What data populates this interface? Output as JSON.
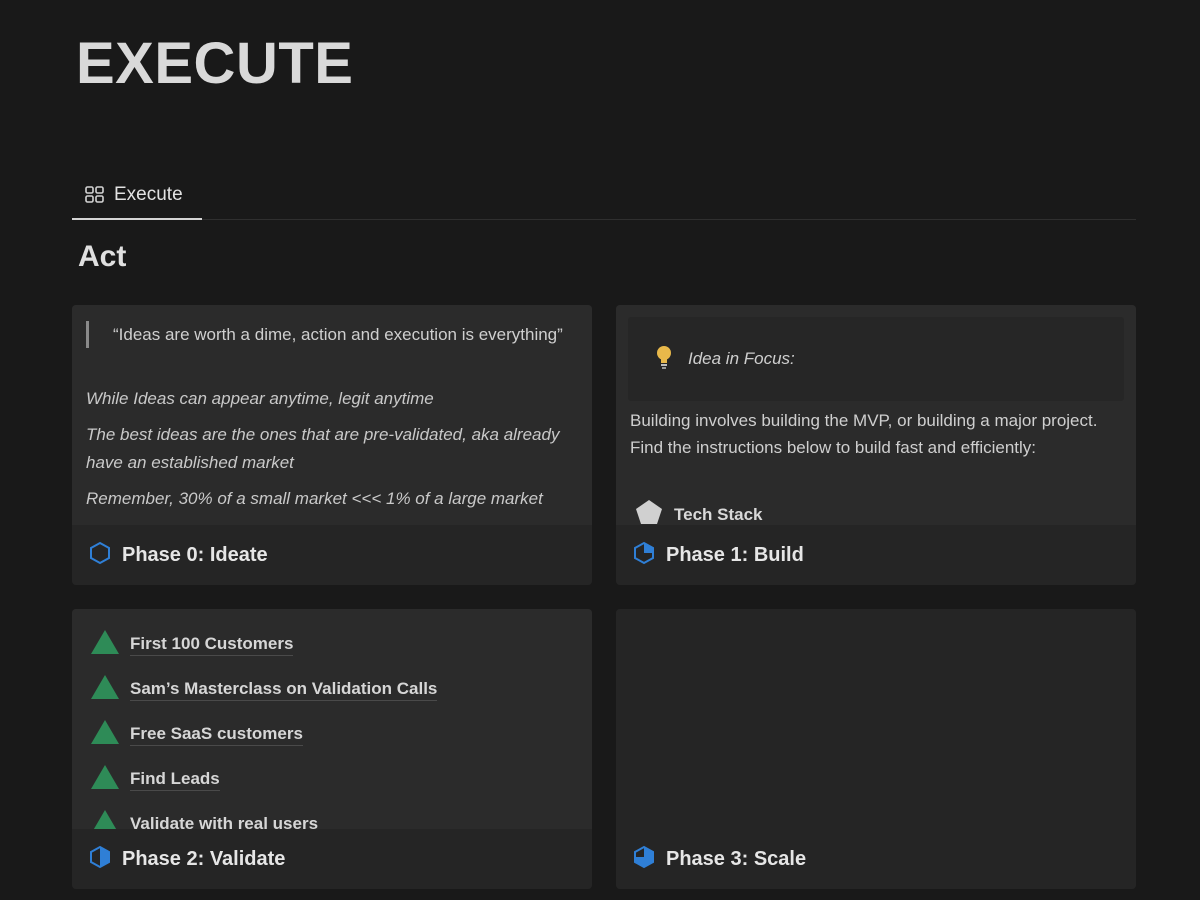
{
  "page": {
    "title": "EXECUTE"
  },
  "tabs": [
    {
      "label": "Execute",
      "icon": "gallery-grid-icon"
    }
  ],
  "section": {
    "heading": "Act"
  },
  "cards": [
    {
      "title": "Phase 0: Ideate",
      "icon": "hexagon-outline-icon",
      "quote": "“Ideas are worth a dime, action and execution is everything”",
      "lines": [
        "While Ideas can appear anytime, legit anytime",
        "The best ideas are the ones that are pre-validated, aka already have an established market",
        "Remember, 30% of a small market <<< 1% of a large market"
      ]
    },
    {
      "title": "Phase 1: Build",
      "icon": "hexagon-quarter-icon",
      "callout": "Idea in Focus:",
      "callout_icon": "lightbulb-icon",
      "body": "Building involves building the MVP, or building a major project. Find the instructions below to build fast and efficiently:",
      "link": {
        "label": "Tech Stack",
        "icon": "pentagon-icon"
      }
    },
    {
      "title": "Phase 2: Validate",
      "icon": "hexagon-half-icon",
      "items": [
        "First 100 Customers",
        "Sam’s Masterclass on Validation Calls",
        "Free SaaS customers",
        "Find Leads",
        "Validate with real users"
      ],
      "item_icon": "green-triangle-icon"
    },
    {
      "title": "Phase 3: Scale",
      "icon": "hexagon-threequarter-icon"
    }
  ],
  "colors": {
    "background": "#191919",
    "card": "#202020",
    "accent_blue": "#2f7fd6",
    "triangle_green": "#2e8b57"
  }
}
